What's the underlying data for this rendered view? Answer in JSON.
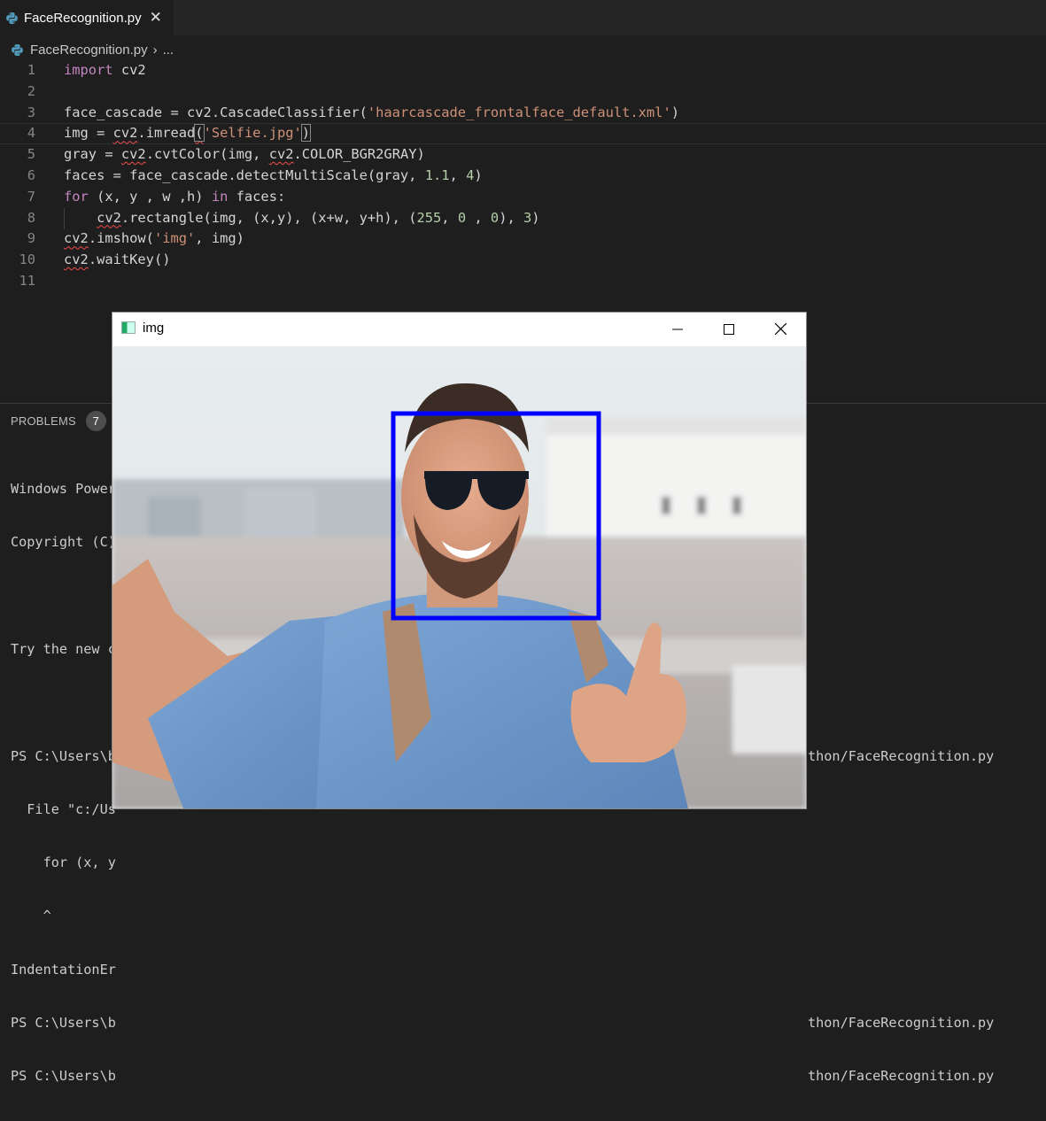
{
  "tab": {
    "filename": "FaceRecognition.py",
    "close": "✕"
  },
  "breadcrumb": {
    "file": "FaceRecognition.py",
    "sep": "›",
    "more": "..."
  },
  "code_lines": [
    "1",
    "2",
    "3",
    "4",
    "5",
    "6",
    "7",
    "8",
    "9",
    "10",
    "11"
  ],
  "code": {
    "l1_kw": "import",
    "l1_rest": " cv2",
    "l3_a": "face_cascade = ",
    "l3_b": "cv2",
    "l3_c": ".CascadeClassifier(",
    "l3_str": "'haarcascade_frontalface_default.xml'",
    "l3_d": ")",
    "l4_a": "img = ",
    "l4_b": "cv2",
    "l4_c": ".imread",
    "l4_p1": "(",
    "l4_str": "'Selfie.jpg'",
    "l4_p2": ")",
    "l5_a": "gray = ",
    "l5_b": "cv2",
    "l5_c": ".cvtColor(img, ",
    "l5_d": "cv2",
    "l5_e": ".COLOR_BGR2GRAY)",
    "l6_a": "faces = face_cascade.detectMultiScale(gray, ",
    "l6_n1": "1.1",
    "l6_b": ", ",
    "l6_n2": "4",
    "l6_c": ")",
    "l7_kw": "for",
    "l7_a": " (x, y , w ,h) ",
    "l7_kw2": "in",
    "l7_b": " faces:",
    "l8_a": "    ",
    "l8_b": "cv2",
    "l8_c": ".rectangle(img, (x,y), (x+w, y+h), (",
    "l8_n1": "255",
    "l8_d": ", ",
    "l8_n2": "0",
    "l8_e": " , ",
    "l8_n3": "0",
    "l8_f": "), ",
    "l8_n4": "3",
    "l8_g": ")",
    "l9_a": "cv2",
    "l9_b": ".imshow(",
    "l9_str": "'img'",
    "l9_c": ", img)",
    "l10_a": "cv2",
    "l10_b": ".waitKey()"
  },
  "panel": {
    "problems_label": "PROBLEMS",
    "problems_count": "7",
    "terminal_left": [
      "Windows Power",
      "Copyright (C)",
      "",
      "Try the new c",
      "",
      "PS C:\\Users\\b",
      "  File \"c:/Us",
      "    for (x, y",
      "    ^",
      "IndentationEr",
      "PS C:\\Users\\b",
      "PS C:\\Users\\b"
    ],
    "terminal_right": [
      "thon/FaceRecognition.py",
      "thon/FaceRecognition.py",
      "thon/FaceRecognition.py"
    ]
  },
  "cv_window": {
    "title": "img",
    "minimize": "—",
    "maximize": "□",
    "close": "✕",
    "rect_color": "#0000ff"
  },
  "colors": {
    "keyword": "#c586c0",
    "string": "#ce9178",
    "number": "#b5cea8",
    "squiggle": "#f14c4c"
  }
}
